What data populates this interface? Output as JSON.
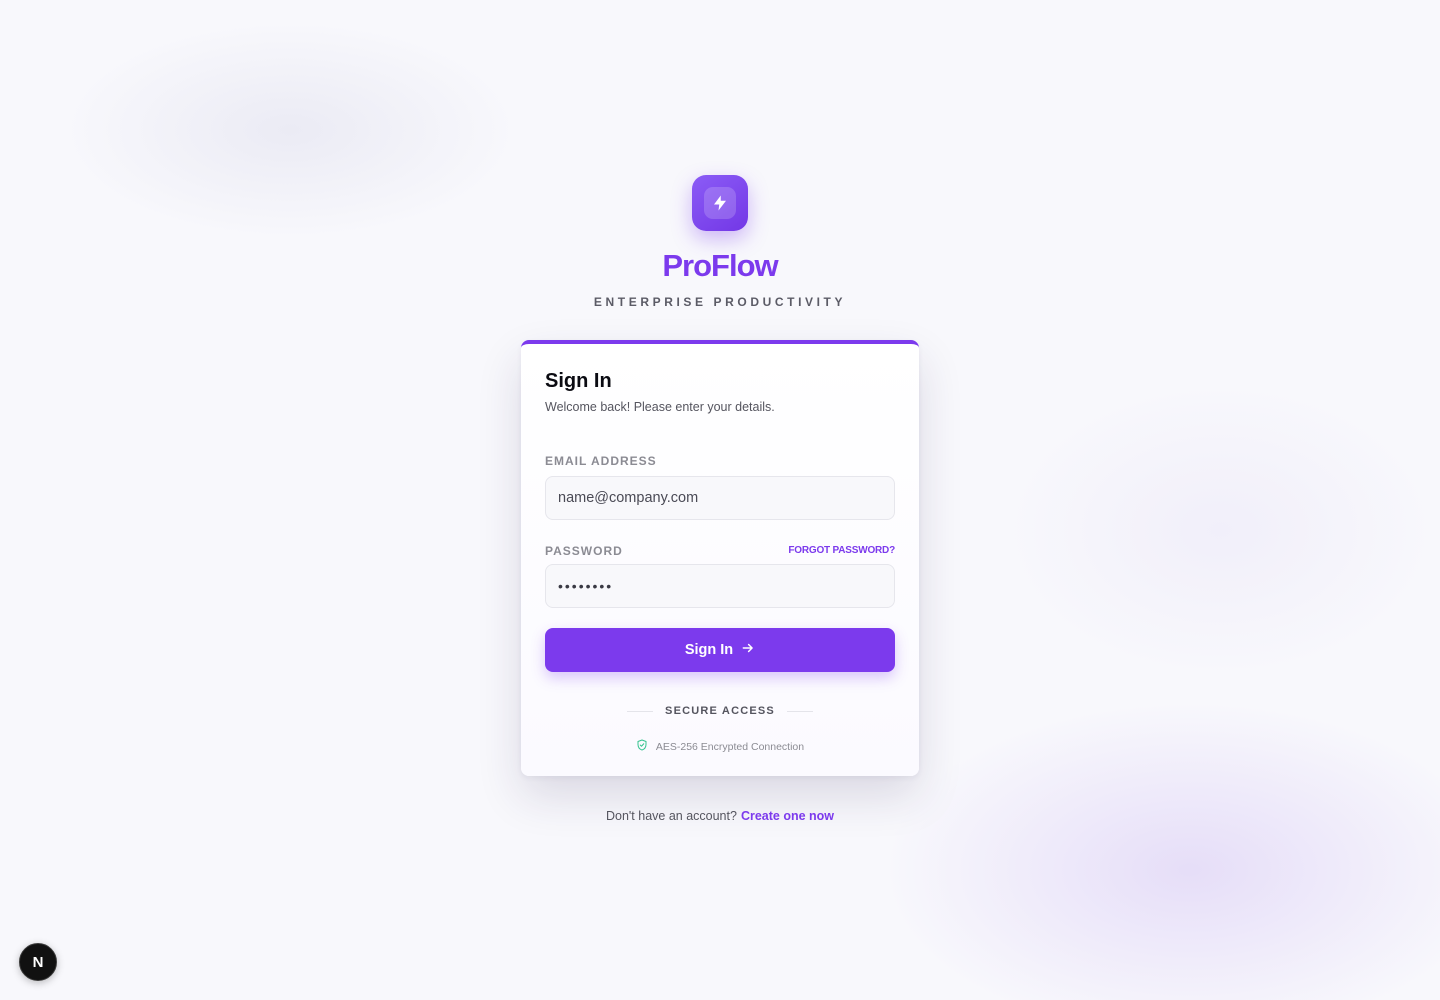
{
  "brand": {
    "name": "ProFlow",
    "tagline": "ENTERPRISE PRODUCTIVITY",
    "logo_icon": "lightning-bolt-icon"
  },
  "card": {
    "title": "Sign In",
    "subtitle": "Welcome back! Please enter your details.",
    "email": {
      "label": "EMAIL ADDRESS",
      "placeholder": "name@company.com",
      "value": ""
    },
    "password": {
      "label": "PASSWORD",
      "value": "password",
      "forgot_label": "FORGOT PASSWORD?"
    },
    "submit_label": "Sign In",
    "divider_label": "SECURE ACCESS",
    "secure_note": "AES-256 Encrypted Connection"
  },
  "footer": {
    "prompt": "Don't have an account?",
    "link_label": "Create one now"
  },
  "badge": {
    "letter": "N"
  },
  "colors": {
    "accent": "#7c3aed",
    "secure_icon": "#34c38f"
  }
}
